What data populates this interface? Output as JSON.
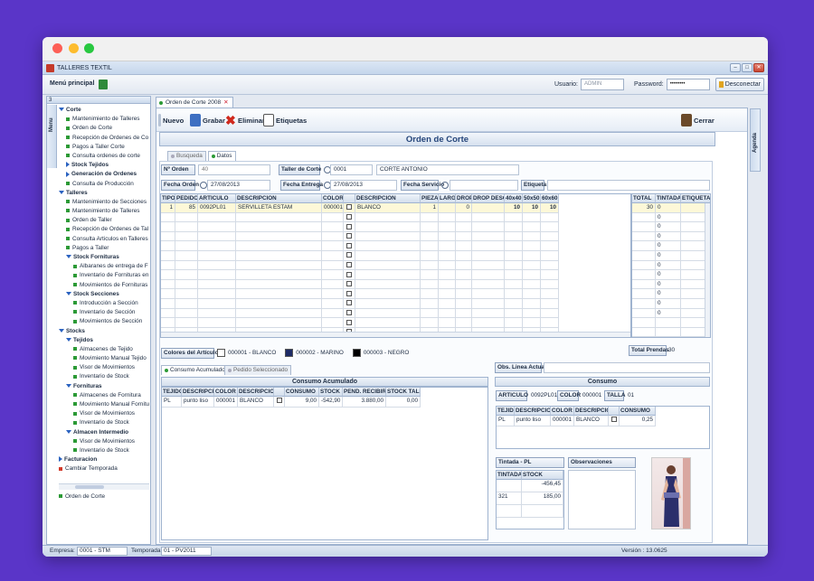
{
  "app": {
    "title": "TALLERES TEXTIL"
  },
  "window_controls": {
    "min": "–",
    "max": "□",
    "close": "✕"
  },
  "menubar": {
    "menu_principal": "Menú principal",
    "usuario_label": "Usuario:",
    "usuario_value": "ADMIN",
    "password_label": "Password:",
    "password_value": "••••••••",
    "disconnect": "Desconectar"
  },
  "sidebar": {
    "tab_label": "Menu",
    "header": "3",
    "items": [
      {
        "label": "Corte",
        "level": 0,
        "kind": "group-open"
      },
      {
        "label": "Mantenimiento de Talleres",
        "level": 1,
        "kind": "leaf"
      },
      {
        "label": "Orden de Corte",
        "level": 1,
        "kind": "leaf"
      },
      {
        "label": "Recepción de Ordenes de Co",
        "level": 1,
        "kind": "leaf"
      },
      {
        "label": "Pagos a Taller Corte",
        "level": 1,
        "kind": "leaf"
      },
      {
        "label": "Consulta ordenes de corte",
        "level": 1,
        "kind": "leaf"
      },
      {
        "label": "Stock Tejidos",
        "level": 1,
        "kind": "group-closed"
      },
      {
        "label": "Generación de Ordenes",
        "level": 1,
        "kind": "group-closed"
      },
      {
        "label": "Consulta de Producción",
        "level": 1,
        "kind": "leaf"
      },
      {
        "label": "Talleres",
        "level": 0,
        "kind": "group-open"
      },
      {
        "label": "Mantenimiento de Secciones",
        "level": 1,
        "kind": "leaf"
      },
      {
        "label": "Mantenimiento de Talleres",
        "level": 1,
        "kind": "leaf"
      },
      {
        "label": "Orden de Taller",
        "level": 1,
        "kind": "leaf"
      },
      {
        "label": "Recepción de Ordenes de Tal",
        "level": 1,
        "kind": "leaf"
      },
      {
        "label": "Consulta Articulos en Talleres",
        "level": 1,
        "kind": "leaf"
      },
      {
        "label": "Pagos a Taller",
        "level": 1,
        "kind": "leaf"
      },
      {
        "label": "Stock Fornituras",
        "level": 1,
        "kind": "group-open"
      },
      {
        "label": "Albaranes de entrega de F",
        "level": 2,
        "kind": "leaf"
      },
      {
        "label": "Inventario de Fornituras en",
        "level": 2,
        "kind": "leaf"
      },
      {
        "label": "Movimientos de Fornituras",
        "level": 2,
        "kind": "leaf"
      },
      {
        "label": "Stock Secciones",
        "level": 1,
        "kind": "group-open"
      },
      {
        "label": "Introducción a Sección",
        "level": 2,
        "kind": "leaf"
      },
      {
        "label": "Inventario de Sección",
        "level": 2,
        "kind": "leaf"
      },
      {
        "label": "Movimientos de Sección",
        "level": 2,
        "kind": "leaf"
      },
      {
        "label": "Stocks",
        "level": 0,
        "kind": "group-open"
      },
      {
        "label": "Tejidos",
        "level": 1,
        "kind": "group-open"
      },
      {
        "label": "Almacenes de Tejido",
        "level": 2,
        "kind": "leaf"
      },
      {
        "label": "Movimiento Manual Tejido",
        "level": 2,
        "kind": "leaf"
      },
      {
        "label": "Visor de Movimientos",
        "level": 2,
        "kind": "leaf"
      },
      {
        "label": "Inventario de Stock",
        "level": 2,
        "kind": "leaf"
      },
      {
        "label": "Fornituras",
        "level": 1,
        "kind": "group-open"
      },
      {
        "label": "Almacenes de Fornitura",
        "level": 2,
        "kind": "leaf"
      },
      {
        "label": "Movimiento Manual Fornitu",
        "level": 2,
        "kind": "leaf"
      },
      {
        "label": "Visor de Movimientos",
        "level": 2,
        "kind": "leaf"
      },
      {
        "label": "Inventario de Stock",
        "level": 2,
        "kind": "leaf"
      },
      {
        "label": "Almacen Intermedio",
        "level": 1,
        "kind": "group-open"
      },
      {
        "label": "Visor de Movimientos",
        "level": 2,
        "kind": "leaf"
      },
      {
        "label": "Inventario de Stock",
        "level": 2,
        "kind": "leaf"
      },
      {
        "label": "Facturacion",
        "level": 0,
        "kind": "group-closed"
      },
      {
        "label": "Cambiar Temporada",
        "level": 0,
        "kind": "red"
      }
    ],
    "footer_item": "Orden de Corte",
    "right_tab": "Agenda"
  },
  "doc_tab": {
    "label": "Orden de Corte 2008",
    "close": "✕"
  },
  "toolbar": {
    "nuevo": "Nuevo",
    "grabar": "Grabar",
    "eliminar": "Eliminar",
    "etiquetas": "Etiquetas",
    "cerrar": "Cerrar"
  },
  "form": {
    "title": "Orden de Corte",
    "tab_busqueda": "Busqueda",
    "tab_datos": "Datos",
    "norden_label": "Nº Orden",
    "norden_value": "40",
    "taller_label": "Taller de Corte",
    "taller_code": "0001",
    "taller_name": "CORTE ANTONIO",
    "fecha_orden_label": "Fecha Orden",
    "fecha_orden_value": "27/08/2013",
    "fecha_entrega_label": "Fecha Entrega",
    "fecha_entrega_value": "27/08/2013",
    "fecha_servicio_label": "Fecha Servicio",
    "fecha_servicio_value": "",
    "etiqueta_label": "Etiqueta",
    "etiqueta_value": ""
  },
  "main_grid": {
    "headers": [
      "TIPO",
      "PEDIDO",
      "ARTICULO",
      "DESCRIPCION",
      "COLOR",
      "",
      "DESCRIPCION",
      "PIEZA",
      "LARGO",
      "DROP",
      "DROP DESC.",
      "40x40",
      "50x50",
      "60x60"
    ],
    "row": [
      "1",
      "85",
      "0092PL01",
      "SERVILLETA ESTAM",
      "000001",
      "",
      "BLANCO",
      "1",
      "",
      "0",
      "",
      "10",
      "10",
      "10"
    ],
    "right_headers": [
      "TOTAL",
      "TINTADA",
      "ETIQUETA"
    ],
    "right_rows": [
      [
        "30",
        "0",
        ""
      ],
      [
        "",
        "0",
        ""
      ],
      [
        "",
        "0",
        ""
      ],
      [
        "",
        "0",
        ""
      ],
      [
        "",
        "0",
        ""
      ],
      [
        "",
        "0",
        ""
      ],
      [
        "",
        "0",
        ""
      ],
      [
        "",
        "0",
        ""
      ],
      [
        "",
        "0",
        ""
      ],
      [
        "",
        "0",
        ""
      ],
      [
        "",
        "0",
        ""
      ],
      [
        "",
        "0",
        ""
      ]
    ]
  },
  "colors": {
    "label": "Colores del Artículo",
    "items": [
      {
        "text": "000001 - BLANCO",
        "color": "#ffffff"
      },
      {
        "text": "000002 - MARINO",
        "color": "#1e2b66"
      },
      {
        "text": "000003 - NEGRO",
        "color": "#000000"
      }
    ],
    "total_label": "Total Prendas",
    "total_value": "30"
  },
  "consumo_tabs": {
    "acumulado": "Consumo Acumulado",
    "pedido": "Pedido Seleccionado"
  },
  "consumo_acumulado": {
    "title": "Consumo Acumulado",
    "headers": [
      "TEJIDO",
      "DESCRIPCION",
      "COLOR",
      "DESCRIPCION",
      "",
      "CONSUMO",
      "STOCK",
      "PEND. RECIBIR",
      "STOCK TALLER"
    ],
    "row": [
      "PL",
      "punto liso",
      "000001",
      "BLANCO",
      "",
      "9,00",
      "-542,90",
      "3.880,00",
      "0,00"
    ]
  },
  "obs_linea": {
    "label": "Obs. Linea Actual",
    "value": ""
  },
  "consumo": {
    "title": "Consumo",
    "articulo_label": "ARTICULO",
    "articulo_value": "0092PL01",
    "color_label": "COLOR",
    "color_value": "000001",
    "talla_label": "TALLA",
    "talla_value": "01",
    "headers": [
      "TEJIDO",
      "DESCRIPCION",
      "COLOR",
      "DESCRIPCION",
      "",
      "CONSUMO"
    ],
    "row": [
      "PL",
      "punto liso",
      "000001",
      "BLANCO",
      "",
      "0,25"
    ]
  },
  "tintada": {
    "label": "Tintada - PL",
    "headers": [
      "TINTADA",
      "STOCK"
    ],
    "rows": [
      [
        "",
        "-456,45"
      ],
      [
        "321",
        "185,00"
      ]
    ]
  },
  "observaciones": {
    "label": "Observaciones",
    "value": ""
  },
  "statusbar": {
    "empresa_label": "Empresa:",
    "empresa_value": "0001 - STM",
    "temporada_label": "Temporada:",
    "temporada_value": "01 - PV2011",
    "version": "Versión : 13.0625"
  }
}
